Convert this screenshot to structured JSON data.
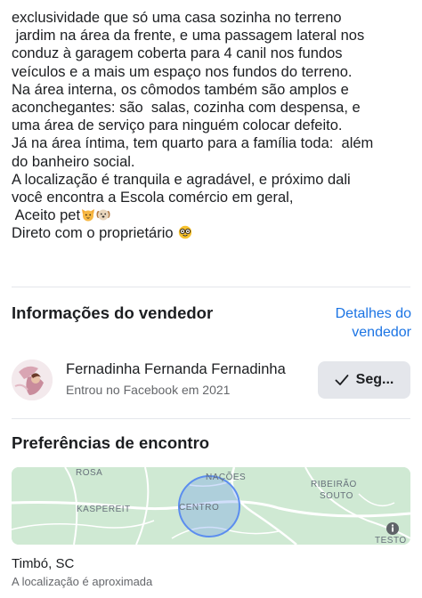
{
  "description": {
    "lines": [
      "exclusividade que só uma casa sozinha no terreno",
      " jardim na área da frente, e uma passagem lateral nos",
      "conduz à garagem coberta para 4 canil nos fundos",
      "veículos e a mais um espaço nos fundos do terreno.",
      "Na área interna, os cômodos também são amplos e",
      "aconchegantes: são  salas, cozinha com despensa, e",
      "uma área de serviço para ninguém colocar defeito.",
      "Já na área íntima, tem quarto para a família toda:  além",
      "do banheiro social.",
      "A localização é tranquila e agradável, e próximo dali",
      "você encontra a Escola comércio em geral,"
    ],
    "pets_line": " Aceito pet",
    "direct_line": "Direto com o proprietário"
  },
  "seller": {
    "section_title": "Informações do vendedor",
    "details_link": "Detalhes do vendedor",
    "name": "Fernadinha Fernanda Fernadinha",
    "joined": "Entrou no Facebook em 2021",
    "follow_label": "Seg..."
  },
  "meeting": {
    "section_title": "Preferências de encontro",
    "map_labels": {
      "rosa": "ROSA",
      "nacoes": "NAÇÕES",
      "ribeirao": "RIBEIRÃO",
      "souto": "SOUTO",
      "kaspereit": "KASPEREIT",
      "centro": "CENTRO",
      "testo": "TESTO"
    },
    "city": "Timbó, SC",
    "approx_note": "A localização é aproximada"
  },
  "colors": {
    "link": "#1b74e4",
    "map_bg": "#cfe9d3",
    "map_circle": "#5b8def"
  },
  "icons": {
    "cat_emoji": "cat-face-emoji-icon",
    "dog_emoji": "dog-face-emoji-icon",
    "nerd_emoji": "nerd-face-emoji-icon",
    "check": "check-icon",
    "info": "info-icon"
  }
}
